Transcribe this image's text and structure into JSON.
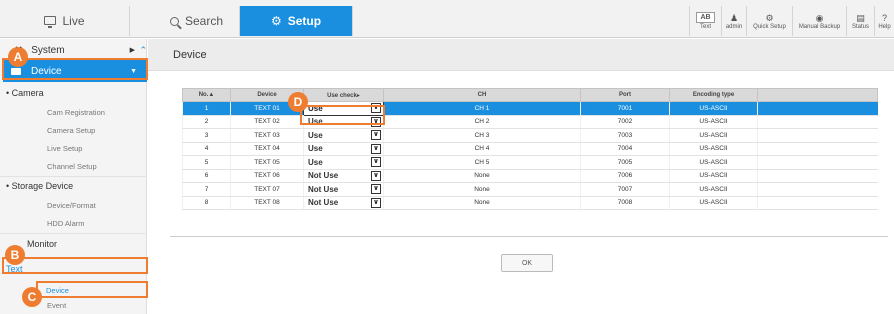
{
  "nav": {
    "tabs": [
      {
        "label": "Live",
        "icon": "monitor-icon"
      },
      {
        "label": "Search",
        "icon": "search-icon"
      },
      {
        "label": "Setup",
        "icon": "gear-icon"
      }
    ],
    "active_color": "#1a8fe0"
  },
  "toolbar": {
    "text_badge": "AB",
    "text_label": "Text",
    "admin_label": "admin",
    "quick_setup_label": "Quick Setup",
    "manual_backup_label": "Manual Backup",
    "status_label": "Status",
    "help_label": "Help"
  },
  "sidebar": {
    "system_label": "System",
    "device_label": "Device",
    "camera": {
      "label": "Camera",
      "items": [
        "Cam Registration",
        "Camera Setup",
        "Live Setup",
        "Channel Setup"
      ]
    },
    "storage": {
      "label": "Storage Device",
      "items": [
        "Device/Format",
        "HDD Alarm"
      ]
    },
    "monitor_label": "Monitor",
    "text_label": "Text",
    "text_items": [
      "Device",
      "Event"
    ]
  },
  "page": {
    "title": "Device",
    "ok_label": "OK"
  },
  "table": {
    "headers": [
      "No.▲",
      "Device",
      "Use check▸",
      "CH",
      "Port",
      "Encoding type"
    ],
    "rows": [
      {
        "no": "1",
        "device": "TEXT 01",
        "use": "Use",
        "ch": "CH 1",
        "port": "7001",
        "enc": "US-ASCII"
      },
      {
        "no": "2",
        "device": "TEXT 02",
        "use": "Use",
        "ch": "CH 2",
        "port": "7002",
        "enc": "US-ASCII"
      },
      {
        "no": "3",
        "device": "TEXT 03",
        "use": "Use",
        "ch": "CH 3",
        "port": "7003",
        "enc": "US-ASCII"
      },
      {
        "no": "4",
        "device": "TEXT 04",
        "use": "Use",
        "ch": "CH 4",
        "port": "7004",
        "enc": "US-ASCII"
      },
      {
        "no": "5",
        "device": "TEXT 05",
        "use": "Use",
        "ch": "CH 5",
        "port": "7005",
        "enc": "US-ASCII"
      },
      {
        "no": "6",
        "device": "TEXT 06",
        "use": "Not Use",
        "ch": "None",
        "port": "7006",
        "enc": "US-ASCII"
      },
      {
        "no": "7",
        "device": "TEXT 07",
        "use": "Not Use",
        "ch": "None",
        "port": "7007",
        "enc": "US-ASCII"
      },
      {
        "no": "8",
        "device": "TEXT 08",
        "use": "Not Use",
        "ch": "None",
        "port": "7008",
        "enc": "US-ASCII"
      }
    ]
  },
  "annotations": {
    "labels": [
      "A",
      "B",
      "C",
      "D"
    ],
    "color": "#ef7d31"
  }
}
